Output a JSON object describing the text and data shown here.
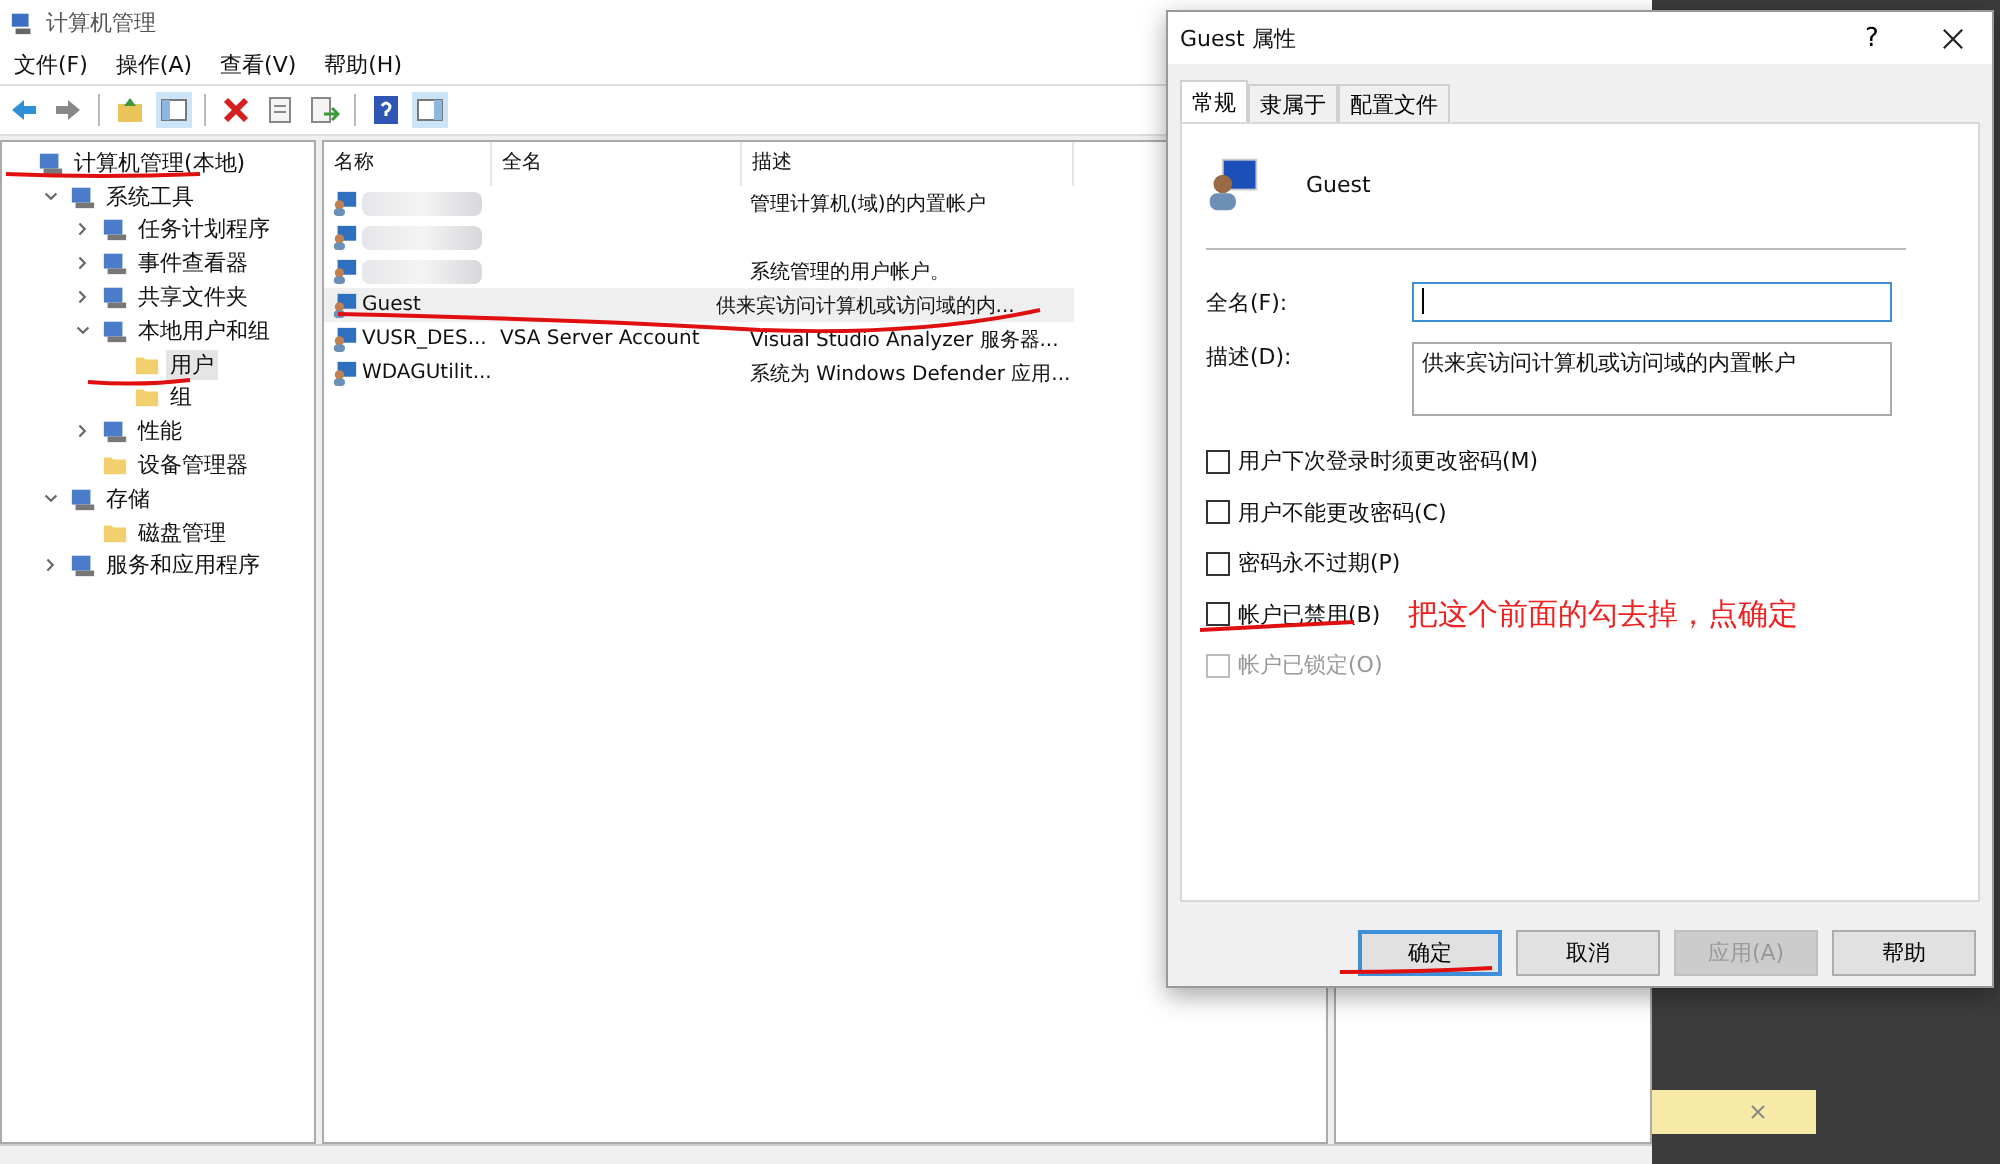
{
  "window": {
    "title": "计算机管理"
  },
  "menu": [
    "文件(F)",
    "操作(A)",
    "查看(V)",
    "帮助(H)"
  ],
  "tree": [
    {
      "label": "计算机管理(本地)",
      "selected": false,
      "children": [
        {
          "label": "系统工具",
          "expanded": true,
          "selected": false,
          "children": [
            {
              "label": "任务计划程序",
              "expanded": false,
              "selected": false
            },
            {
              "label": "事件查看器",
              "expanded": false,
              "selected": false
            },
            {
              "label": "共享文件夹",
              "expanded": false,
              "selected": false
            },
            {
              "label": "本地用户和组",
              "expanded": true,
              "selected": false,
              "children": [
                {
                  "label": "用户",
                  "selected": true
                },
                {
                  "label": "组",
                  "selected": false
                }
              ]
            },
            {
              "label": "性能",
              "expanded": false,
              "selected": false
            },
            {
              "label": "设备管理器",
              "selected": false
            }
          ]
        },
        {
          "label": "存储",
          "expanded": true,
          "selected": false,
          "children": [
            {
              "label": "磁盘管理",
              "selected": false
            }
          ]
        },
        {
          "label": "服务和应用程序",
          "expanded": false,
          "selected": false
        }
      ]
    }
  ],
  "table": {
    "columns": [
      "名称",
      "全名",
      "描述"
    ],
    "rows": [
      {
        "redacted": true,
        "selected": false,
        "description": "管理计算机(域)的内置帐户"
      },
      {
        "redacted": true,
        "selected": false
      },
      {
        "redacted": true,
        "selected": false,
        "description": "系统管理的用户帐户。"
      },
      {
        "redacted": false,
        "selected": true,
        "name": "Guest",
        "description": "供来宾访问计算机或访问域的内..."
      },
      {
        "redacted": false,
        "selected": false,
        "name": "VUSR_DES...",
        "full_name": "VSA Server Account",
        "description": "Visual Studio Analyzer 服务器..."
      },
      {
        "redacted": false,
        "selected": false,
        "name": "WDAGUtilit...",
        "description": "系统为 Windows Defender 应用..."
      }
    ]
  },
  "dialog": {
    "title": "Guest 属性",
    "help": "?",
    "tabs": [
      {
        "label": "常规",
        "selected": true
      },
      {
        "label": "隶属于",
        "selected": false
      },
      {
        "label": "配置文件",
        "selected": false
      }
    ],
    "user_name": "Guest",
    "full_name": {
      "label": "全名(F):"
    },
    "description": {
      "label": "描述(D):",
      "value": "供来宾访问计算机或访问域的内置帐户"
    },
    "checkboxes": [
      {
        "label": "用户下次登录时须更改密码(M)",
        "checked": false,
        "disabled": false
      },
      {
        "label": "用户不能更改密码(C)",
        "checked": false,
        "disabled": false
      },
      {
        "label": "密码永不过期(P)",
        "checked": false,
        "disabled": false
      },
      {
        "label": "帐户已禁用(B)",
        "checked": false,
        "disabled": false
      },
      {
        "label": "帐户已锁定(O)",
        "checked": false,
        "disabled": true
      }
    ],
    "buttons": [
      {
        "label": "确定",
        "default": true,
        "disabled": false
      },
      {
        "label": "取消",
        "default": false,
        "disabled": false
      },
      {
        "label": "应用(A)",
        "default": false,
        "disabled": true
      },
      {
        "label": "帮助",
        "default": false,
        "disabled": false
      }
    ]
  },
  "annotation": {
    "text": "把这个前面的勾去掉，点确定"
  }
}
